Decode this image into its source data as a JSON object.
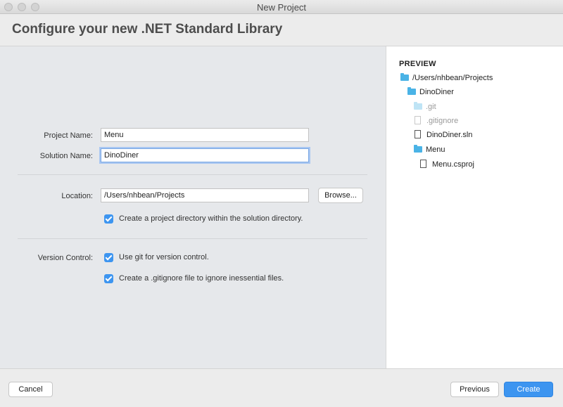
{
  "window": {
    "title": "New Project"
  },
  "header": {
    "title": "Configure your new .NET Standard Library"
  },
  "form": {
    "project_name_label": "Project Name:",
    "project_name_value": "Menu",
    "solution_name_label": "Solution Name:",
    "solution_name_value": "DinoDiner",
    "location_label": "Location:",
    "location_value": "/Users/nhbean/Projects",
    "browse_label": "Browse...",
    "create_dir_label": "Create a project directory within the solution directory.",
    "create_dir_checked": true,
    "version_control_label": "Version Control:",
    "use_git_label": "Use git for version control.",
    "use_git_checked": true,
    "gitignore_label": "Create a .gitignore file to ignore inessential files.",
    "gitignore_checked": true
  },
  "preview": {
    "heading": "PREVIEW",
    "items": [
      {
        "label": "/Users/nhbean/Projects",
        "icon": "folder-icon",
        "depth": 0,
        "dim": false
      },
      {
        "label": "DinoDiner",
        "icon": "folder-icon",
        "depth": 1,
        "dim": false
      },
      {
        "label": ".git",
        "icon": "folder-icon",
        "depth": 2,
        "dim": true
      },
      {
        "label": ".gitignore",
        "icon": "file-icon",
        "depth": 2,
        "dim": true
      },
      {
        "label": "DinoDiner.sln",
        "icon": "file-icon",
        "depth": 2,
        "dim": false
      },
      {
        "label": "Menu",
        "icon": "folder-icon",
        "depth": 2,
        "dim": false
      },
      {
        "label": "Menu.csproj",
        "icon": "file-icon",
        "depth": 3,
        "dim": false
      }
    ]
  },
  "footer": {
    "cancel_label": "Cancel",
    "previous_label": "Previous",
    "create_label": "Create"
  },
  "colors": {
    "accent": "#3d95f0",
    "folder": "#4ab3e6"
  }
}
